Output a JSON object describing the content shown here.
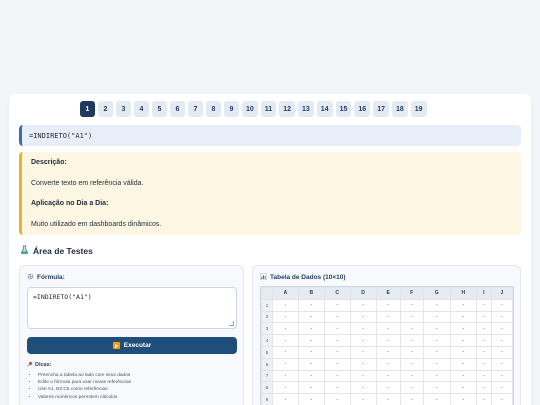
{
  "pager": {
    "pages": [
      "1",
      "2",
      "3",
      "4",
      "5",
      "6",
      "7",
      "8",
      "9",
      "10",
      "11",
      "12",
      "13",
      "14",
      "15",
      "16",
      "17",
      "18",
      "19"
    ],
    "active_index": 0
  },
  "formula_display": "=INDIRETO(\"A1\")",
  "description": {
    "desc_heading": "Descrição:",
    "desc_text": "Converte texto em referência válida.",
    "usage_heading": "Aplicação no Dia a Dia:",
    "usage_text": "Muito utilizado em dashboards dinâmicos."
  },
  "test_area": {
    "title": "Área de Testes",
    "title_icon": "test-tube-icon"
  },
  "formula_panel": {
    "label": "Fórmula:",
    "label_icon": "gear-icon",
    "input_value": "=INDIRETO(\"A1\")",
    "execute_label": "Executar",
    "execute_icon": "play-icon",
    "tips_title": "Dicas:",
    "tips_icon": "pin-icon",
    "tips": [
      "Preencha a tabela ao lado com seus dados",
      "Edite a fórmula para usar novas referências",
      "Use A1, B2:C5 como referências",
      "Valores numéricos permitem cálculos"
    ]
  },
  "data_table": {
    "title": "Tabela de Dados (10×10)",
    "title_icon": "bar-chart-icon",
    "columns": [
      "A",
      "B",
      "C",
      "D",
      "E",
      "F",
      "G",
      "H",
      "I",
      "J"
    ],
    "rows": [
      {
        "label": "1",
        "cells": [
          "-",
          "-",
          "-",
          "-",
          "-",
          "-",
          "-",
          "-",
          "-",
          "-"
        ]
      },
      {
        "label": "2",
        "cells": [
          "-",
          "-",
          "-",
          "-",
          "-",
          "-",
          "-",
          "-",
          "-",
          "-"
        ]
      },
      {
        "label": "3",
        "cells": [
          "-",
          "-",
          "-",
          "-",
          "-",
          "-",
          "-",
          "-",
          "-",
          "-"
        ]
      },
      {
        "label": "4",
        "cells": [
          "-",
          "-",
          "-",
          "-",
          "-",
          "-",
          "-",
          "-",
          "-",
          "-"
        ]
      },
      {
        "label": "5",
        "cells": [
          "-",
          "-",
          "-",
          "-",
          "-",
          "-",
          "-",
          "-",
          "-",
          "-"
        ]
      },
      {
        "label": "6",
        "cells": [
          "-",
          "-",
          "-",
          "-",
          "-",
          "-",
          "-",
          "-",
          "-",
          "-"
        ]
      },
      {
        "label": "7",
        "cells": [
          "-",
          "-",
          "-",
          "-",
          "-",
          "-",
          "-",
          "-",
          "-",
          "-"
        ]
      },
      {
        "label": "8",
        "cells": [
          "-",
          "-",
          "-",
          "-",
          "-",
          "-",
          "-",
          "-",
          "-",
          "-"
        ]
      },
      {
        "label": "9",
        "cells": [
          "-",
          "-",
          "-",
          "-",
          "-",
          "-",
          "-",
          "-",
          "-",
          "-"
        ]
      }
    ]
  },
  "colors": {
    "accent": "#1e3a5f",
    "button": "#1e4e79",
    "info_border": "#3b6ea5",
    "desc_background": "#fdf6e3",
    "desc_border": "#e6b422"
  }
}
